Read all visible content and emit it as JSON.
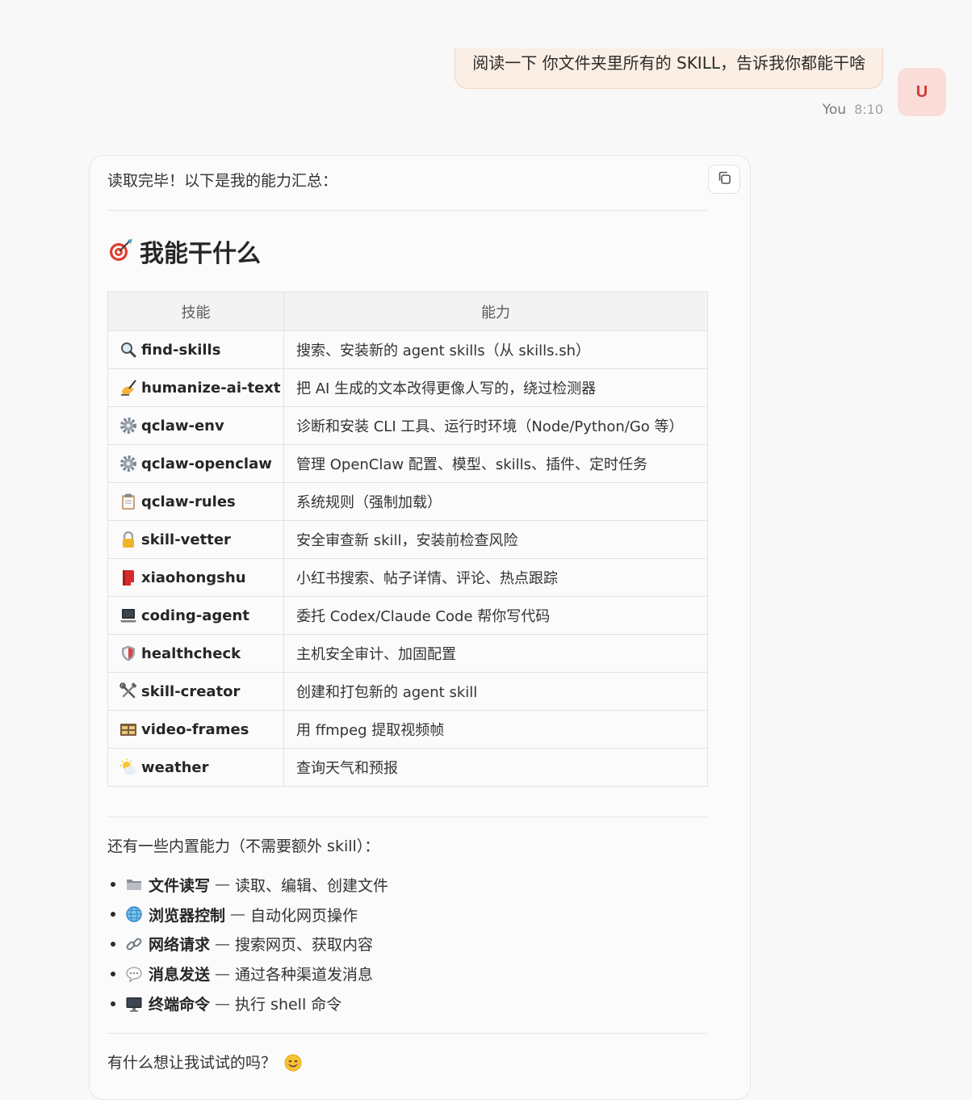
{
  "user_message": {
    "text": "阅读一下 你文件夹里所有的 SKILL，告诉我你都能干啥",
    "sender": "You",
    "time": "8:10",
    "avatar_letter": "U"
  },
  "assistant": {
    "intro": "读取完毕！以下是我的能力汇总：",
    "heading": "我能干什么",
    "heading_icon": "target-icon",
    "table": {
      "headers": [
        "技能",
        "能力"
      ],
      "rows": [
        {
          "icon": "magnifier-icon",
          "skill": "find-skills",
          "capability": "搜索、安装新的 agent skills（从 skills.sh）"
        },
        {
          "icon": "writing-hand-icon",
          "skill": "humanize-ai-text",
          "capability": "把 AI 生成的文本改得更像人写的，绕过检测器"
        },
        {
          "icon": "gear-icon",
          "skill": "qclaw-env",
          "capability": "诊断和安装 CLI 工具、运行时环境（Node/Python/Go 等）"
        },
        {
          "icon": "gear-icon",
          "skill": "qclaw-openclaw",
          "capability": "管理 OpenClaw 配置、模型、skills、插件、定时任务"
        },
        {
          "icon": "clipboard-icon",
          "skill": "qclaw-rules",
          "capability": "系统规则（强制加载）"
        },
        {
          "icon": "lock-icon",
          "skill": "skill-vetter",
          "capability": "安全审查新 skill，安装前检查风险"
        },
        {
          "icon": "red-book-icon",
          "skill": "xiaohongshu",
          "capability": "小红书搜索、帖子详情、评论、热点跟踪"
        },
        {
          "icon": "laptop-icon",
          "skill": "coding-agent",
          "capability": "委托 Codex/Claude Code 帮你写代码"
        },
        {
          "icon": "shield-icon",
          "skill": "healthcheck",
          "capability": "主机安全审计、加固配置"
        },
        {
          "icon": "tools-icon",
          "skill": "skill-creator",
          "capability": "创建和打包新的 agent skill"
        },
        {
          "icon": "film-frames-icon",
          "skill": "video-frames",
          "capability": "用 ffmpeg 提取视频帧"
        },
        {
          "icon": "sun-cloud-icon",
          "skill": "weather",
          "capability": "查询天气和预报"
        }
      ]
    },
    "builtin_intro": "还有一些内置能力（不需要额外 skill）：",
    "builtin": [
      {
        "icon": "folder-icon",
        "title": "文件读写",
        "sep": "—",
        "desc": "读取、编辑、创建文件"
      },
      {
        "icon": "globe-icon",
        "title": "浏览器控制",
        "sep": "—",
        "desc": "自动化网页操作"
      },
      {
        "icon": "link-icon",
        "title": "网络请求",
        "sep": "—",
        "desc": "搜索网页、获取内容"
      },
      {
        "icon": "speech-bubble-icon",
        "title": "消息发送",
        "sep": "—",
        "desc": "通过各种渠道发消息"
      },
      {
        "icon": "desktop-icon",
        "title": "终端命令",
        "sep": "—",
        "desc": "执行 shell 命令"
      }
    ],
    "closing": "有什么想让我试试的吗？",
    "closing_icon": "smile-icon"
  }
}
